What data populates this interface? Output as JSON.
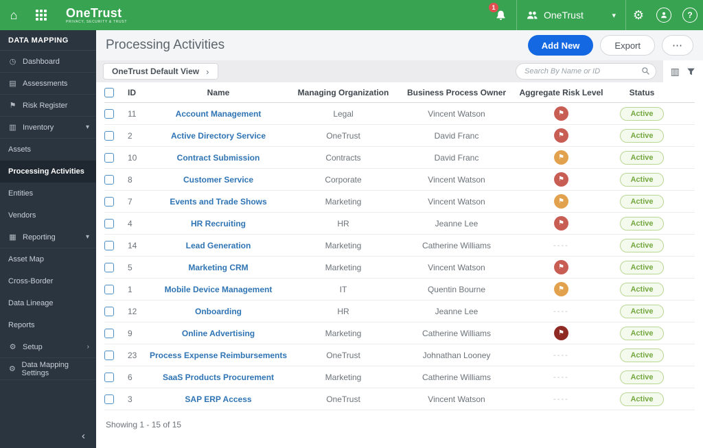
{
  "topbar": {
    "brand": "OneTrust",
    "tagline": "PRIVACY, SECURITY & TRUST",
    "notification_count": "1",
    "org_selector": {
      "label": "OneTrust"
    }
  },
  "sidebar": {
    "section_title": "DATA MAPPING",
    "items": [
      {
        "id": "dashboard",
        "label": "Dashboard",
        "icon": "dashboard-icon",
        "type": "item"
      },
      {
        "id": "assessments",
        "label": "Assessments",
        "icon": "assessments-icon",
        "type": "item"
      },
      {
        "id": "risk-register",
        "label": "Risk Register",
        "icon": "flag-icon",
        "type": "item"
      },
      {
        "id": "inventory",
        "label": "Inventory",
        "icon": "folder-icon",
        "type": "group",
        "chevron": "down"
      },
      {
        "id": "assets",
        "label": "Assets",
        "type": "subitem"
      },
      {
        "id": "processing-activities",
        "label": "Processing Activities",
        "type": "subitem",
        "active": true
      },
      {
        "id": "entities",
        "label": "Entities",
        "type": "subitem"
      },
      {
        "id": "vendors",
        "label": "Vendors",
        "type": "subitem"
      },
      {
        "id": "reporting",
        "label": "Reporting",
        "icon": "chart-icon",
        "type": "group",
        "chevron": "down"
      },
      {
        "id": "asset-map",
        "label": "Asset Map",
        "type": "subitem"
      },
      {
        "id": "cross-border",
        "label": "Cross-Border",
        "type": "subitem"
      },
      {
        "id": "data-lineage",
        "label": "Data Lineage",
        "type": "subitem"
      },
      {
        "id": "reports",
        "label": "Reports",
        "type": "subitem"
      },
      {
        "id": "setup",
        "label": "Setup",
        "icon": "wrench-icon",
        "type": "group",
        "chevron": "right"
      },
      {
        "id": "data-mapping-settings",
        "label": "Data Mapping Settings",
        "icon": "gear-icon",
        "type": "item"
      }
    ]
  },
  "page": {
    "title": "Processing Activities",
    "add_new_label": "Add New",
    "export_label": "Export"
  },
  "toolbar": {
    "view_label": "OneTrust Default View",
    "search_placeholder": "Search By Name or ID"
  },
  "table": {
    "columns": [
      "ID",
      "Name",
      "Managing Organization",
      "Business Process Owner",
      "Aggregate Risk Level",
      "Status"
    ],
    "risk_empty_label": "----",
    "rows": [
      {
        "id": "11",
        "name": "Account Management",
        "org": "Legal",
        "owner": "Vincent Watson",
        "risk": "high",
        "status": "Active"
      },
      {
        "id": "2",
        "name": "Active Directory Service",
        "org": "OneTrust",
        "owner": "David Franc",
        "risk": "high",
        "status": "Active"
      },
      {
        "id": "10",
        "name": "Contract Submission",
        "org": "Contracts",
        "owner": "David Franc",
        "risk": "medium",
        "status": "Active"
      },
      {
        "id": "8",
        "name": "Customer Service",
        "org": "Corporate",
        "owner": "Vincent Watson",
        "risk": "high",
        "status": "Active"
      },
      {
        "id": "7",
        "name": "Events and Trade Shows",
        "org": "Marketing",
        "owner": "Vincent Watson",
        "risk": "medium",
        "status": "Active"
      },
      {
        "id": "4",
        "name": "HR Recruiting",
        "org": "HR",
        "owner": "Jeanne Lee",
        "risk": "high",
        "status": "Active"
      },
      {
        "id": "14",
        "name": "Lead Generation",
        "org": "Marketing",
        "owner": "Catherine Williams",
        "risk": "none",
        "status": "Active"
      },
      {
        "id": "5",
        "name": "Marketing CRM",
        "org": "Marketing",
        "owner": "Vincent Watson",
        "risk": "high",
        "status": "Active"
      },
      {
        "id": "1",
        "name": "Mobile Device Management",
        "org": "IT",
        "owner": "Quentin Bourne",
        "risk": "medium",
        "status": "Active"
      },
      {
        "id": "12",
        "name": "Onboarding",
        "org": "HR",
        "owner": "Jeanne Lee",
        "risk": "none",
        "status": "Active"
      },
      {
        "id": "9",
        "name": "Online Advertising",
        "org": "Marketing",
        "owner": "Catherine Williams",
        "risk": "very-high",
        "status": "Active"
      },
      {
        "id": "23",
        "name": "Process Expense Reimbursements",
        "org": "OneTrust",
        "owner": "Johnathan Looney",
        "risk": "none",
        "status": "Active"
      },
      {
        "id": "6",
        "name": "SaaS Products Procurement",
        "org": "Marketing",
        "owner": "Catherine Williams",
        "risk": "none",
        "status": "Active"
      },
      {
        "id": "3",
        "name": "SAP ERP Access",
        "org": "OneTrust",
        "owner": "Vincent Watson",
        "risk": "none",
        "status": "Active"
      }
    ]
  },
  "footer": {
    "showing_label": "Showing 1 - 15 of 15"
  },
  "colors": {
    "brand_green": "#38a351",
    "primary_blue": "#1468e2",
    "link_blue": "#2f74b4",
    "status_green": "#73a83f",
    "risk_high": "#c75d53",
    "risk_medium": "#e2a24d",
    "risk_very_high": "#8e2a23"
  }
}
